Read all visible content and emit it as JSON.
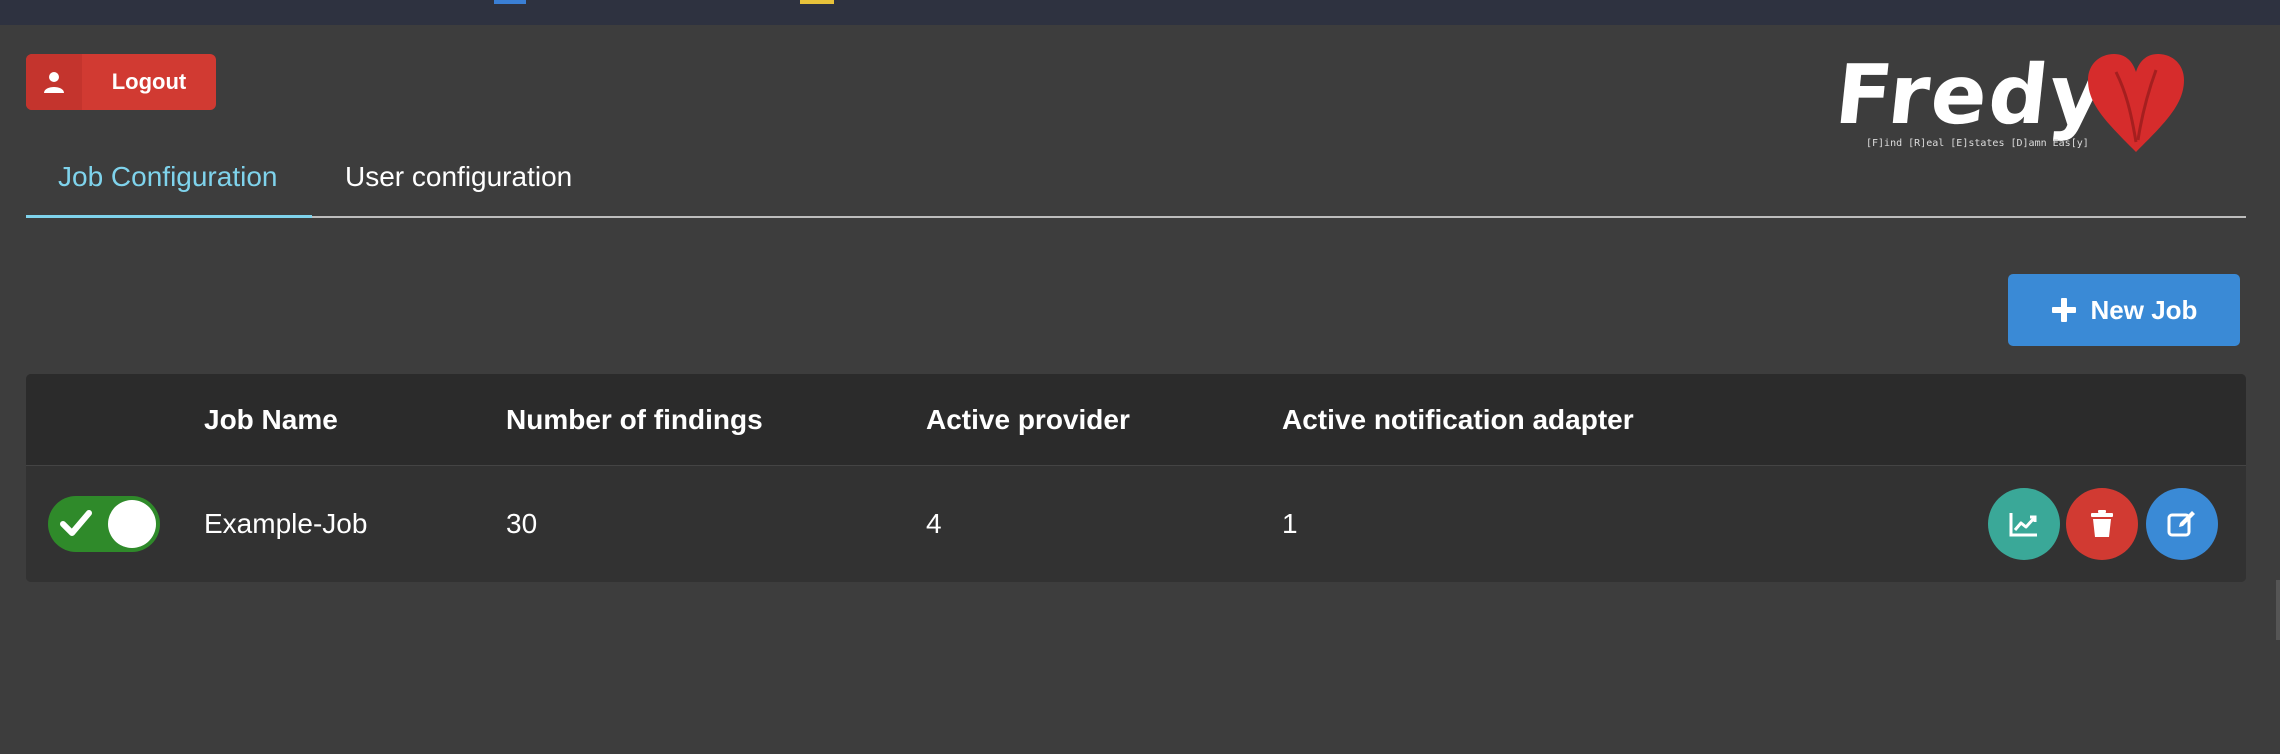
{
  "header": {
    "logout_label": "Logout",
    "logo_text": "Fredy",
    "logo_subtitle": "[F]ind [R]eal [E]states [D]amn Eas[y]"
  },
  "tabs": [
    {
      "label": "Job Configuration",
      "active": true
    },
    {
      "label": "User configuration",
      "active": false
    }
  ],
  "actions": {
    "new_job_label": "New Job"
  },
  "table": {
    "columns": [
      "Job Name",
      "Number of findings",
      "Active provider",
      "Active notification adapter"
    ],
    "rows": [
      {
        "enabled": true,
        "job_name": "Example-Job",
        "findings": "30",
        "active_provider": "4",
        "active_notification_adapter": "1"
      }
    ]
  },
  "icons": {
    "logout": "user-icon",
    "new_job": "plus-icon",
    "toggle": "check-icon",
    "chart": "chart-line-icon",
    "delete": "trash-icon",
    "edit": "edit-icon"
  },
  "colors": {
    "background": "#3d3d3d",
    "topbar": "#2e3240",
    "logout": "#d13a32",
    "accent_tab": "#7fd3ec",
    "primary": "#3a8ad6",
    "teal": "#3aa898",
    "toggle_on": "#2f8a2a",
    "heart": "#d62c2c"
  }
}
